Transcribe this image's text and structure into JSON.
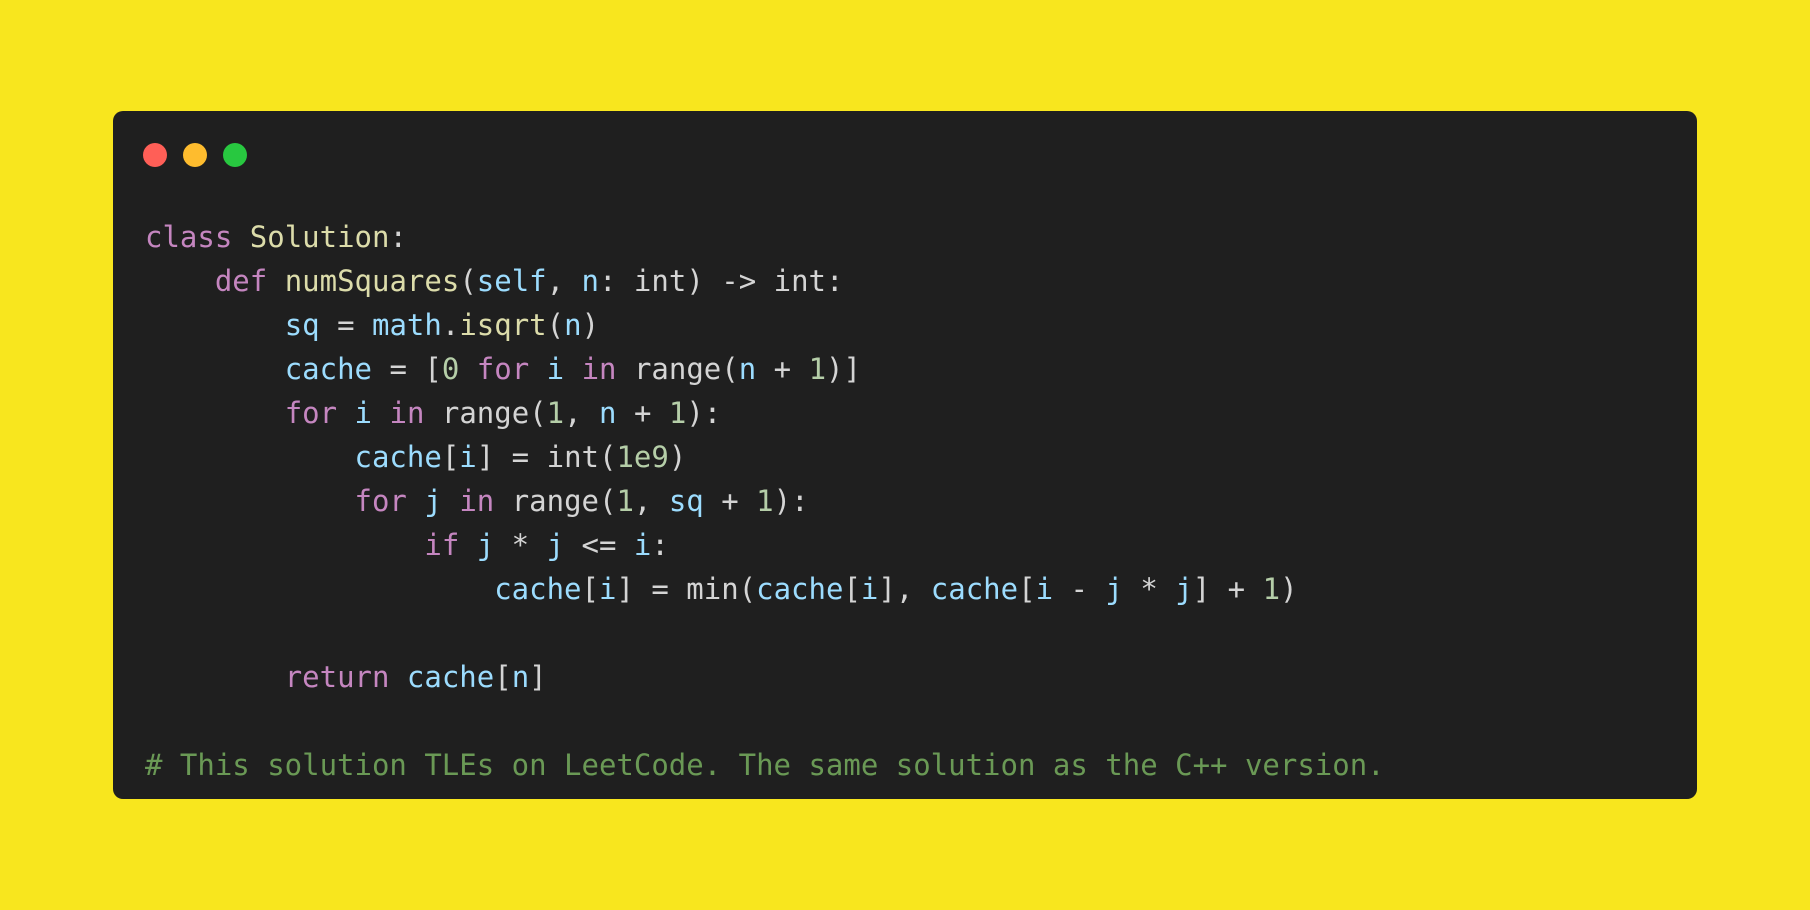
{
  "window": {
    "controls": {
      "close_color": "#ff5f57",
      "minimize_color": "#febc2e",
      "maximize_color": "#28c840"
    }
  },
  "code": {
    "language": "python",
    "lines": [
      [
        {
          "t": "class",
          "c": "kw"
        },
        {
          "t": " ",
          "c": "pl"
        },
        {
          "t": "Solution",
          "c": "cls"
        },
        {
          "t": ":",
          "c": "pl"
        }
      ],
      [
        {
          "t": "    ",
          "c": "pl"
        },
        {
          "t": "def",
          "c": "kw"
        },
        {
          "t": " ",
          "c": "pl"
        },
        {
          "t": "numSquares",
          "c": "fn"
        },
        {
          "t": "(",
          "c": "pl"
        },
        {
          "t": "self",
          "c": "var"
        },
        {
          "t": ", ",
          "c": "pl"
        },
        {
          "t": "n",
          "c": "var"
        },
        {
          "t": ": int) -> int:",
          "c": "pl"
        }
      ],
      [
        {
          "t": "        ",
          "c": "pl"
        },
        {
          "t": "sq",
          "c": "var"
        },
        {
          "t": " = ",
          "c": "pl"
        },
        {
          "t": "math",
          "c": "var"
        },
        {
          "t": ".",
          "c": "pl"
        },
        {
          "t": "isqrt",
          "c": "fn"
        },
        {
          "t": "(",
          "c": "pl"
        },
        {
          "t": "n",
          "c": "var"
        },
        {
          "t": ")",
          "c": "pl"
        }
      ],
      [
        {
          "t": "        ",
          "c": "pl"
        },
        {
          "t": "cache",
          "c": "var"
        },
        {
          "t": " = [",
          "c": "pl"
        },
        {
          "t": "0",
          "c": "num"
        },
        {
          "t": " ",
          "c": "pl"
        },
        {
          "t": "for",
          "c": "kw"
        },
        {
          "t": " ",
          "c": "pl"
        },
        {
          "t": "i",
          "c": "var"
        },
        {
          "t": " ",
          "c": "pl"
        },
        {
          "t": "in",
          "c": "kw"
        },
        {
          "t": " range(",
          "c": "pl"
        },
        {
          "t": "n",
          "c": "var"
        },
        {
          "t": " + ",
          "c": "pl"
        },
        {
          "t": "1",
          "c": "num"
        },
        {
          "t": ")]",
          "c": "pl"
        }
      ],
      [
        {
          "t": "        ",
          "c": "pl"
        },
        {
          "t": "for",
          "c": "kw"
        },
        {
          "t": " ",
          "c": "pl"
        },
        {
          "t": "i",
          "c": "var"
        },
        {
          "t": " ",
          "c": "pl"
        },
        {
          "t": "in",
          "c": "kw"
        },
        {
          "t": " range(",
          "c": "pl"
        },
        {
          "t": "1",
          "c": "num"
        },
        {
          "t": ", ",
          "c": "pl"
        },
        {
          "t": "n",
          "c": "var"
        },
        {
          "t": " + ",
          "c": "pl"
        },
        {
          "t": "1",
          "c": "num"
        },
        {
          "t": "):",
          "c": "pl"
        }
      ],
      [
        {
          "t": "            ",
          "c": "pl"
        },
        {
          "t": "cache",
          "c": "var"
        },
        {
          "t": "[",
          "c": "pl"
        },
        {
          "t": "i",
          "c": "var"
        },
        {
          "t": "] = int(",
          "c": "pl"
        },
        {
          "t": "1e9",
          "c": "num"
        },
        {
          "t": ")",
          "c": "pl"
        }
      ],
      [
        {
          "t": "            ",
          "c": "pl"
        },
        {
          "t": "for",
          "c": "kw"
        },
        {
          "t": " ",
          "c": "pl"
        },
        {
          "t": "j",
          "c": "var"
        },
        {
          "t": " ",
          "c": "pl"
        },
        {
          "t": "in",
          "c": "kw"
        },
        {
          "t": " range(",
          "c": "pl"
        },
        {
          "t": "1",
          "c": "num"
        },
        {
          "t": ", ",
          "c": "pl"
        },
        {
          "t": "sq",
          "c": "var"
        },
        {
          "t": " + ",
          "c": "pl"
        },
        {
          "t": "1",
          "c": "num"
        },
        {
          "t": "):",
          "c": "pl"
        }
      ],
      [
        {
          "t": "                ",
          "c": "pl"
        },
        {
          "t": "if",
          "c": "kw"
        },
        {
          "t": " ",
          "c": "pl"
        },
        {
          "t": "j",
          "c": "var"
        },
        {
          "t": " * ",
          "c": "pl"
        },
        {
          "t": "j",
          "c": "var"
        },
        {
          "t": " <= ",
          "c": "pl"
        },
        {
          "t": "i",
          "c": "var"
        },
        {
          "t": ":",
          "c": "pl"
        }
      ],
      [
        {
          "t": "                    ",
          "c": "pl"
        },
        {
          "t": "cache",
          "c": "var"
        },
        {
          "t": "[",
          "c": "pl"
        },
        {
          "t": "i",
          "c": "var"
        },
        {
          "t": "] = min(",
          "c": "pl"
        },
        {
          "t": "cache",
          "c": "var"
        },
        {
          "t": "[",
          "c": "pl"
        },
        {
          "t": "i",
          "c": "var"
        },
        {
          "t": "], ",
          "c": "pl"
        },
        {
          "t": "cache",
          "c": "var"
        },
        {
          "t": "[",
          "c": "pl"
        },
        {
          "t": "i",
          "c": "var"
        },
        {
          "t": " - ",
          "c": "pl"
        },
        {
          "t": "j",
          "c": "var"
        },
        {
          "t": " * ",
          "c": "pl"
        },
        {
          "t": "j",
          "c": "var"
        },
        {
          "t": "] + ",
          "c": "pl"
        },
        {
          "t": "1",
          "c": "num"
        },
        {
          "t": ")",
          "c": "pl"
        }
      ],
      [],
      [
        {
          "t": "        ",
          "c": "pl"
        },
        {
          "t": "return",
          "c": "kw"
        },
        {
          "t": " ",
          "c": "pl"
        },
        {
          "t": "cache",
          "c": "var"
        },
        {
          "t": "[",
          "c": "pl"
        },
        {
          "t": "n",
          "c": "var"
        },
        {
          "t": "]",
          "c": "pl"
        }
      ],
      [],
      [
        {
          "t": "# This solution TLEs on LeetCode. The same solution as the C++ version.",
          "c": "cm"
        }
      ]
    ]
  }
}
